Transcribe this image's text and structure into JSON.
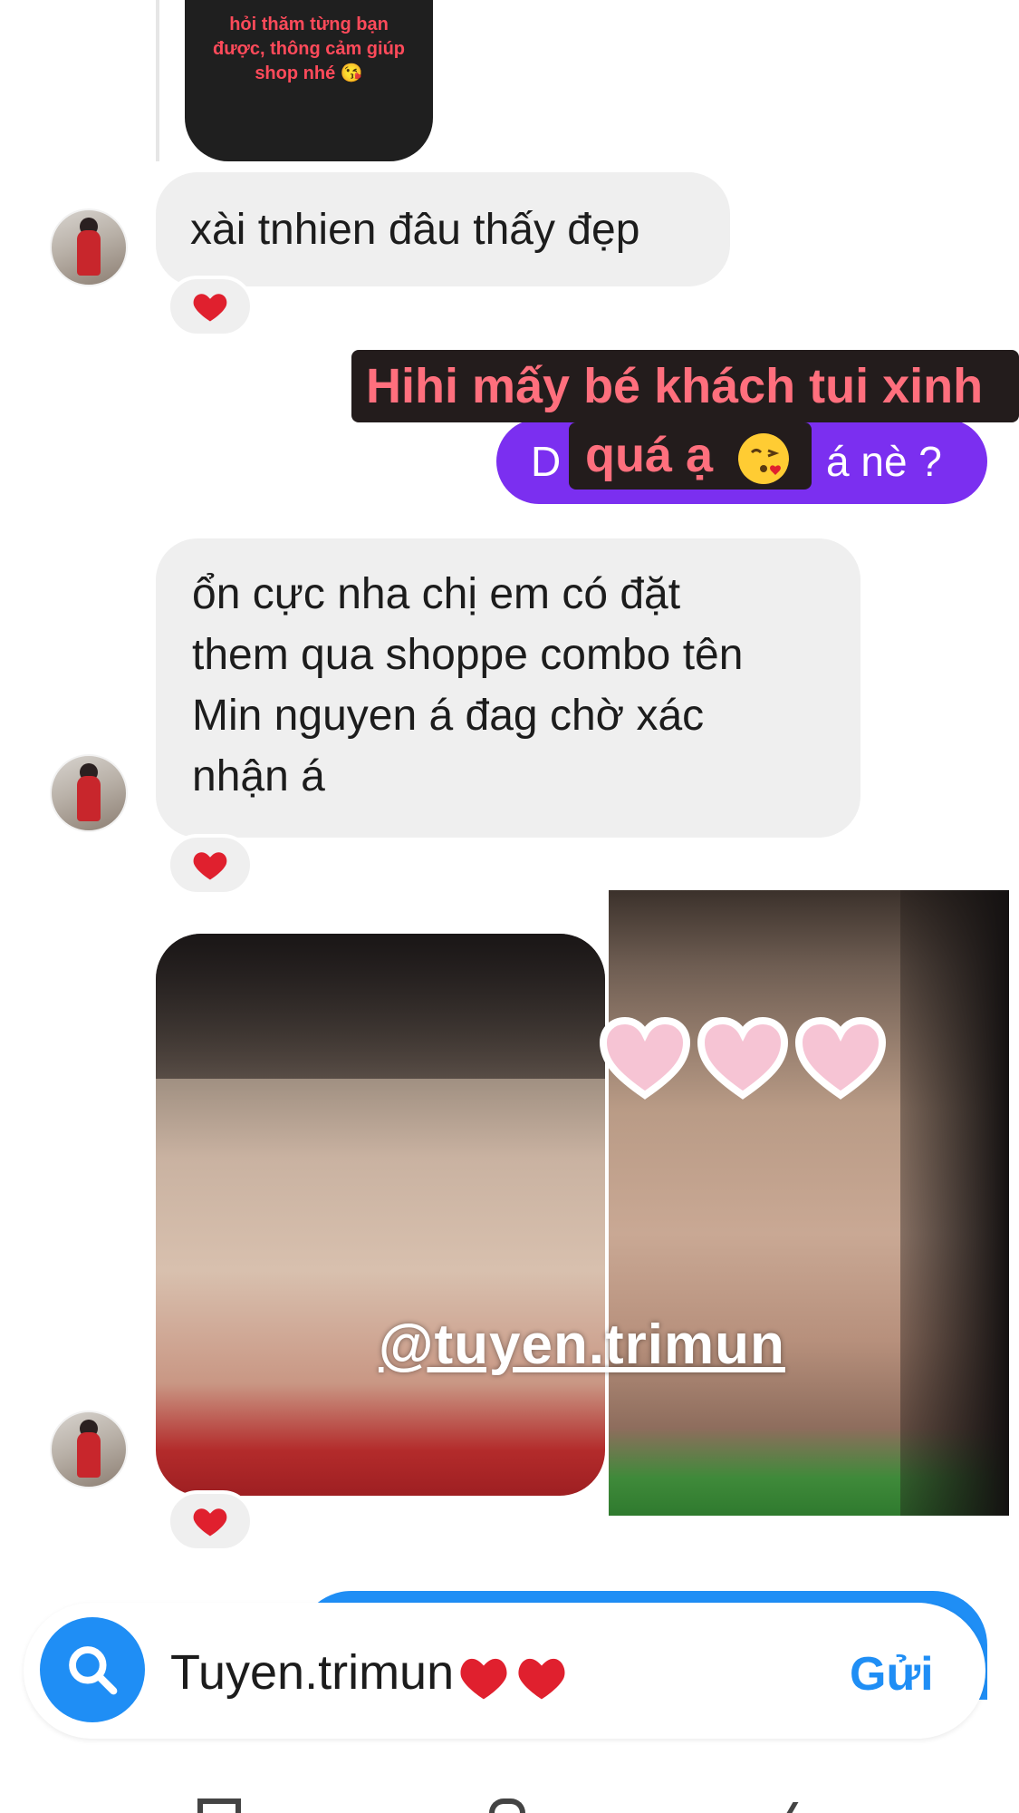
{
  "story_reply": {
    "text_lines": [
      "hỏi thăm từng bạn",
      "được, thông cảm giúp",
      "shop nhé 😘"
    ]
  },
  "messages": [
    {
      "text": "xài tnhien đâu thấy đẹp",
      "reaction": "❤️"
    },
    {
      "lines": [
        "ổn cực nha chị em có đặt",
        "them qua shoppe combo tên",
        "Min nguyen á đag chờ xác",
        "nhận á"
      ],
      "reaction": "❤️"
    },
    {
      "reaction": "❤️"
    }
  ],
  "outgoing": {
    "visible_start": "D",
    "visible_end": "á nè ?"
  },
  "captions": {
    "line1": "Hihi mấy bé khách tui xinh",
    "line2": "quá ạ",
    "line2_emoji": "😘"
  },
  "watermark": "@tuyen.trimun",
  "composer": {
    "text": "Tuyen.trimun",
    "send_label": "Gửi"
  },
  "colors": {
    "outgoing_bubble": "#7b2ff0",
    "incoming_bubble": "#efefef",
    "accent_blue": "#1f8ef5",
    "caption_text": "#ff6f7d",
    "reaction_heart": "#e0202e"
  },
  "icons": [
    "heart-icon",
    "search-icon",
    "pink-heart-sticker",
    "kiss-emoji"
  ]
}
